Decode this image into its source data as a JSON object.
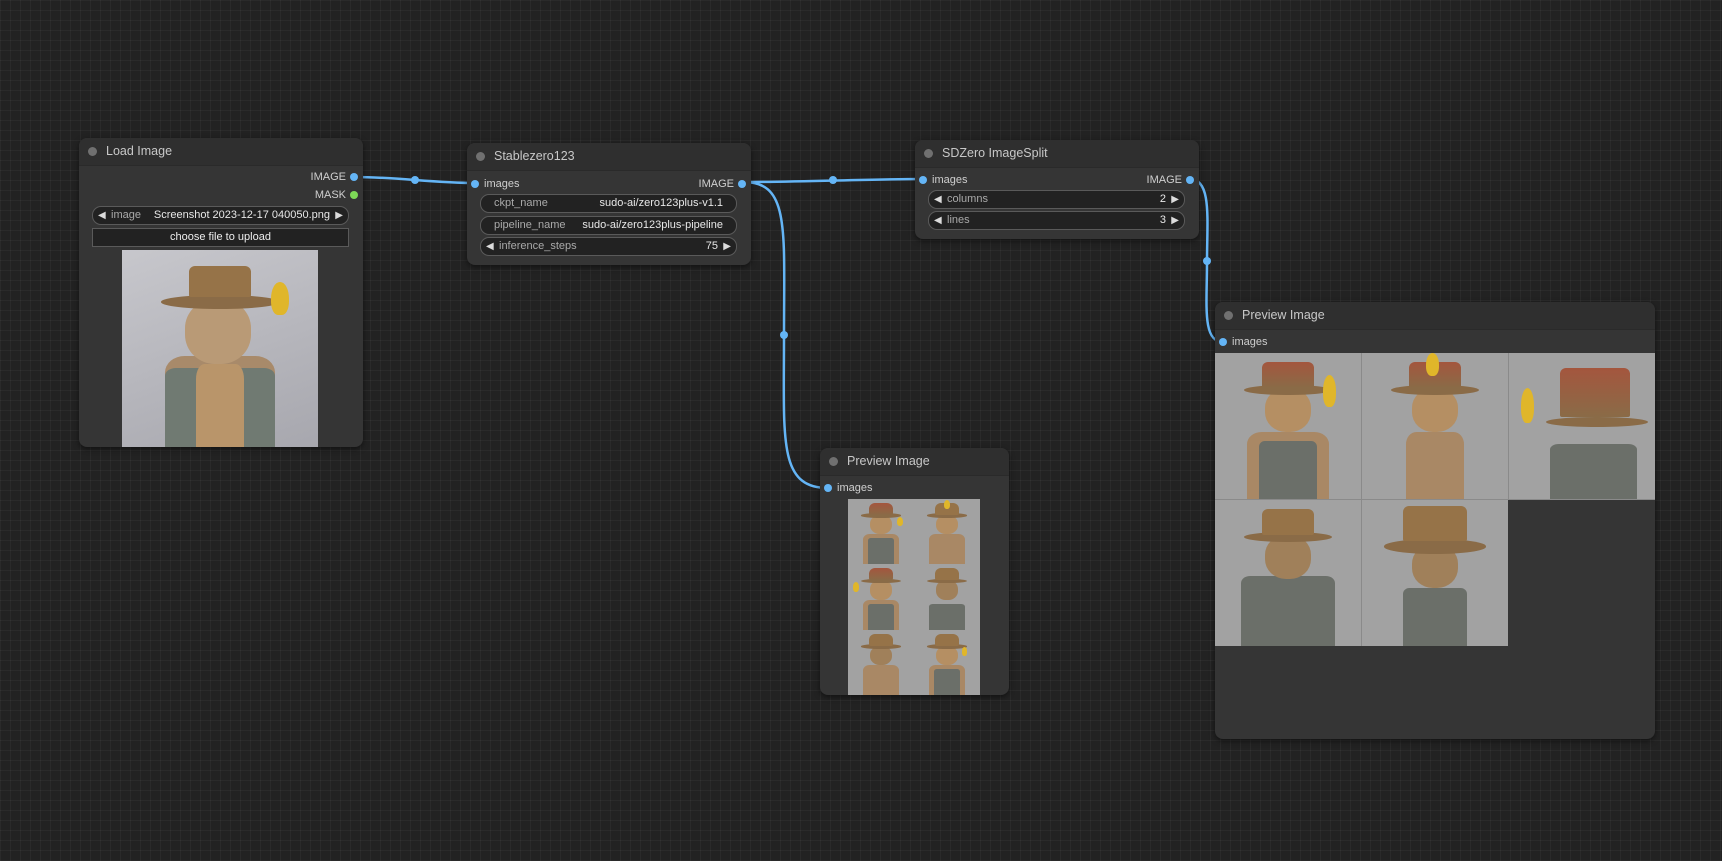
{
  "colors": {
    "canvas": "#222222",
    "node": "#353535",
    "title_bar": "#2f2f2f",
    "image_link": "#64b5f6",
    "mask_slot": "#7ed957"
  },
  "nodes": {
    "load_image": {
      "title": "Load Image",
      "outputs": [
        "IMAGE",
        "MASK"
      ],
      "image_widget": {
        "label": "image",
        "value": "Screenshot 2023-12-17 040050.png"
      },
      "upload_button": "choose file to upload",
      "preview": "scarecrow-with-yellow-bird-photo"
    },
    "stablezero123": {
      "title": "Stablezero123",
      "input": "images",
      "output": "IMAGE",
      "widgets": [
        {
          "label": "ckpt_name",
          "value": "sudo-ai/zero123plus-v1.1"
        },
        {
          "label": "pipeline_name",
          "value": "sudo-ai/zero123plus-pipeline"
        },
        {
          "label": "inference_steps",
          "value": "75"
        }
      ]
    },
    "imagesplit": {
      "title": "SDZero ImageSplit",
      "input": "images",
      "output": "IMAGE",
      "widgets": [
        {
          "label": "columns",
          "value": "2"
        },
        {
          "label": "lines",
          "value": "3"
        }
      ]
    },
    "preview_small": {
      "title": "Preview Image",
      "input": "images",
      "preview": "six-view-grid-2x3"
    },
    "preview_large": {
      "title": "Preview Image",
      "input": "images",
      "preview": "five-split-views-3x2"
    }
  }
}
